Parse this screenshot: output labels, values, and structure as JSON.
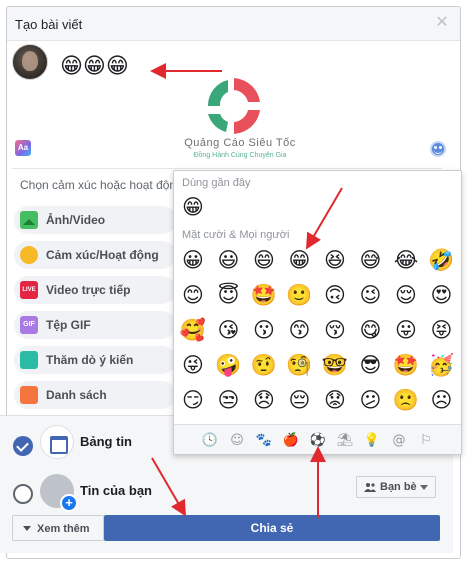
{
  "dialog": {
    "title": "Tạo bài viết",
    "close_glyph": "✕"
  },
  "post": {
    "text": "😁😁😁",
    "feeling_placeholder": "Chọn cảm xúc hoặc hoạt động"
  },
  "watermark": {
    "brand": "Quảng Cáo Siêu Tốc",
    "tagline": "Đồng Hành Cùng Chuyên Gia"
  },
  "composer_icons": {
    "text_format": "Aa",
    "emoji": "emoji-icon"
  },
  "options": [
    {
      "label": "Ảnh/Video",
      "icon": "photo-icon"
    },
    {
      "label": "Cảm xúc/Hoạt động",
      "icon": "feeling-icon"
    },
    {
      "label": "Video trực tiếp",
      "icon": "live-icon",
      "badge": "LIVE"
    },
    {
      "label": "Tệp GIF",
      "icon": "gif-icon",
      "badge": "GIF"
    },
    {
      "label": "Thăm dò ý kiến",
      "icon": "poll-icon"
    },
    {
      "label": "Danh sách",
      "icon": "list-icon"
    }
  ],
  "audience": {
    "feed_label": "Bảng tin",
    "story_label": "Tin của bạn",
    "friends_label": "Bạn bè",
    "story_plus": "+"
  },
  "actions": {
    "more_label": "Xem thêm",
    "share_label": "Chia sẻ"
  },
  "picker": {
    "recent_title": "Dùng gần đây",
    "recent": [
      "😁"
    ],
    "smileys_title": "Mặt cười & Mọi người",
    "smileys": [
      [
        "😀",
        "😃",
        "😄",
        "😁",
        "😆",
        "😅",
        "😂",
        "🤣"
      ],
      [
        "😊",
        "😇",
        "🤩",
        "🙂",
        "🙃",
        "😉",
        "😌",
        "😍"
      ],
      [
        "🥰",
        "😘",
        "😗",
        "😙",
        "😚",
        "😋",
        "😛",
        "😝"
      ],
      [
        "😜",
        "🤪",
        "🤨",
        "🧐",
        "🤓",
        "😎",
        "🤩",
        "🥳"
      ],
      [
        "😏",
        "😒",
        "😞",
        "😔",
        "😟",
        "😕",
        "🙁",
        "☹"
      ]
    ],
    "tabs": [
      {
        "glyph": "🕓",
        "name": "recent-tab-icon"
      },
      {
        "glyph": "☺",
        "name": "smileys-tab-icon"
      },
      {
        "glyph": "🐾",
        "name": "animals-tab-icon"
      },
      {
        "glyph": "🍎",
        "name": "food-tab-icon"
      },
      {
        "glyph": "⚽",
        "name": "activity-tab-icon"
      },
      {
        "glyph": "⛱",
        "name": "travel-tab-icon"
      },
      {
        "glyph": "💡",
        "name": "objects-tab-icon"
      },
      {
        "glyph": "@",
        "name": "symbols-tab-icon"
      },
      {
        "glyph": "⚐",
        "name": "flags-tab-icon"
      }
    ]
  },
  "colors": {
    "primary": "#4267b2",
    "annotation_arrow": "#e0282e",
    "watermark_red": "#e8505b",
    "watermark_green": "#3aa77a"
  }
}
